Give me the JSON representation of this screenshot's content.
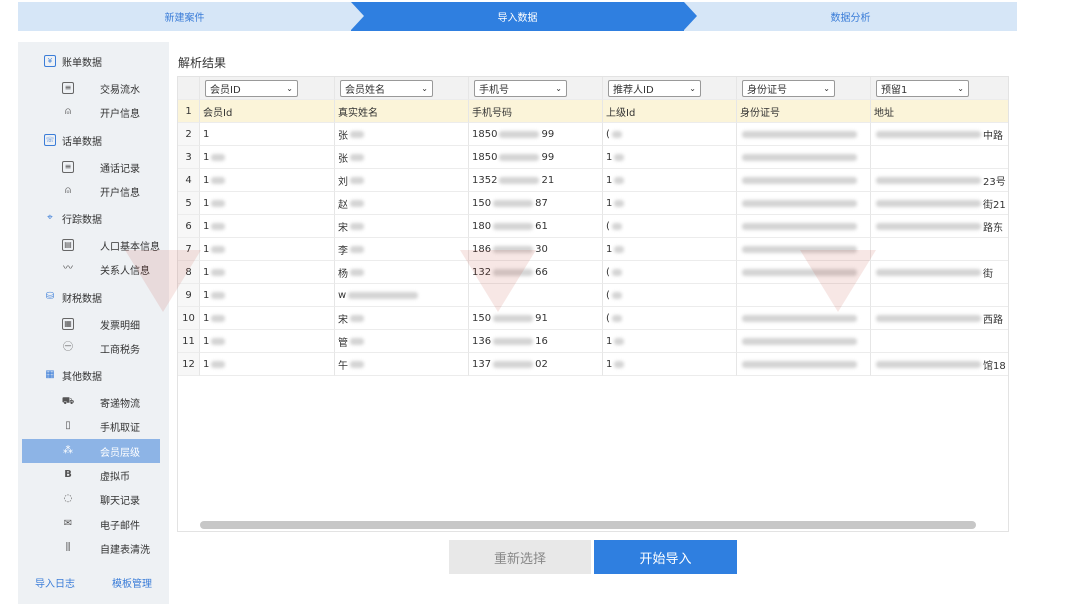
{
  "stepper": {
    "steps": [
      {
        "label": "新建案件"
      },
      {
        "label": "导入数据"
      },
      {
        "label": "数据分析"
      }
    ]
  },
  "sidebar": {
    "categories": [
      {
        "label": "账单数据",
        "icon": "ledger-icon",
        "children": [
          {
            "label": "交易流水",
            "icon": "document-icon"
          },
          {
            "label": "开户信息",
            "icon": "person-icon"
          }
        ]
      },
      {
        "label": "话单数据",
        "icon": "call-record-icon",
        "children": [
          {
            "label": "通话记录",
            "icon": "document-icon"
          },
          {
            "label": "开户信息",
            "icon": "person-icon"
          }
        ]
      },
      {
        "label": "行踪数据",
        "icon": "track-icon",
        "children": [
          {
            "label": "人口基本信息",
            "icon": "id-card-icon"
          },
          {
            "label": "关系人信息",
            "icon": "relation-icon"
          }
        ]
      },
      {
        "label": "财税数据",
        "icon": "coins-icon",
        "children": [
          {
            "label": "发票明细",
            "icon": "invoice-icon"
          },
          {
            "label": "工商税务",
            "icon": "tax-icon"
          }
        ]
      },
      {
        "label": "其他数据",
        "icon": "grid-icon",
        "children": [
          {
            "label": "寄递物流",
            "icon": "truck-icon"
          },
          {
            "label": "手机取证",
            "icon": "phone-icon"
          },
          {
            "label": "会员层级",
            "icon": "hierarchy-icon",
            "active": true
          },
          {
            "label": "虚拟币",
            "icon": "bitcoin-icon"
          },
          {
            "label": "聊天记录",
            "icon": "chat-icon"
          },
          {
            "label": "电子邮件",
            "icon": "mail-icon"
          },
          {
            "label": "自建表清洗",
            "icon": "table-clean-icon"
          }
        ]
      }
    ],
    "footer": {
      "import_log": "导入日志",
      "template_manage": "模板管理"
    }
  },
  "main": {
    "result_title": "解析结果",
    "column_selects": [
      "会员ID",
      "会员姓名",
      "手机号",
      "推荐人ID",
      "身份证号",
      "预留1"
    ],
    "header_row": {
      "num": "1",
      "cells": [
        "会员Id",
        "真实姓名",
        "手机号码",
        "上级Id",
        "身份证号",
        "地址"
      ]
    },
    "rows": [
      {
        "num": "2",
        "cells": [
          "1",
          "张",
          "1850",
          "(",
          "",
          "中路"
        ]
      },
      {
        "num": "3",
        "cells": [
          "1",
          "张",
          "1850",
          "1",
          "",
          ""
        ]
      },
      {
        "num": "4",
        "cells": [
          "1",
          "刘",
          "1352",
          "1",
          "",
          "23号"
        ]
      },
      {
        "num": "5",
        "cells": [
          "1",
          "赵",
          "150",
          "1",
          "",
          "街21"
        ]
      },
      {
        "num": "6",
        "cells": [
          "1",
          "宋",
          "180",
          "(",
          "",
          "路东"
        ]
      },
      {
        "num": "7",
        "cells": [
          "1",
          "李",
          "186",
          "1",
          "",
          ""
        ]
      },
      {
        "num": "8",
        "cells": [
          "1",
          "杨",
          "132",
          "(",
          "",
          "街"
        ]
      },
      {
        "num": "9",
        "cells": [
          "1",
          "w",
          "",
          "(",
          "",
          ""
        ]
      },
      {
        "num": "10",
        "cells": [
          "1",
          "宋",
          "150",
          "(",
          "",
          "西路"
        ]
      },
      {
        "num": "11",
        "cells": [
          "1",
          "管",
          "136",
          "1",
          "",
          ""
        ]
      },
      {
        "num": "12",
        "cells": [
          "1",
          "午",
          "137",
          "1",
          "",
          "馆18"
        ]
      }
    ],
    "phone_tails": [
      "99",
      "99",
      "21",
      "87",
      "61",
      "30",
      "66",
      "",
      "91",
      "16",
      "02"
    ]
  },
  "actions": {
    "reset_label": "重新选择",
    "start_label": "开始导入"
  },
  "colors": {
    "primary": "#2f7fe0",
    "step_inactive": "#d6e6f7",
    "sidebar_bg": "#eef1f4",
    "header_row_bg": "#fbf4d9"
  }
}
